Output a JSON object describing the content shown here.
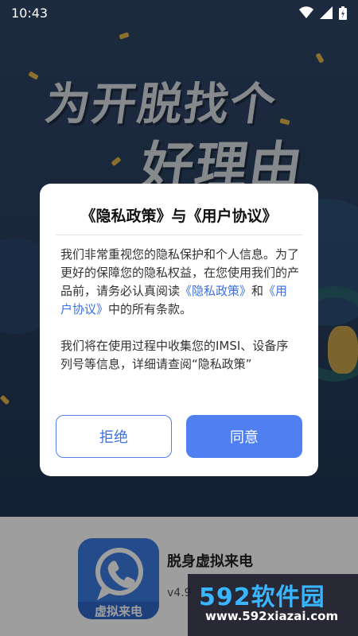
{
  "status_bar": {
    "time": "10:43"
  },
  "splash": {
    "line1": "为开脱找个",
    "line2": "好理由"
  },
  "dialog": {
    "title": "《隐私政策》与《用户协议》",
    "para1_text": "我们非常重视您的隐私保护和个人信息。为了更好的保障您的隐私权益，在您使用我们的产品前，请务必认真阅读",
    "privacy_link": "《隐私政策》",
    "and_text": "和",
    "terms_link": "《用户协议》",
    "para1_tail": "中的所有条款。",
    "para2_text": "我们将在使用过程中收集您的IMSI、设备序列号等信息，详细请查阅“隐私政策”",
    "reject_label": "拒绝",
    "agree_label": "同意"
  },
  "app": {
    "logo_text": "虚拟来电",
    "name": "脱身虚拟来电",
    "version": "v4.9"
  },
  "watermark": {
    "brand": "592软件园",
    "url": "www.592xiazai.com"
  },
  "colors": {
    "accent": "#4f7ff0",
    "link": "#3b6fe4",
    "splash_bg": "#2f4566"
  }
}
